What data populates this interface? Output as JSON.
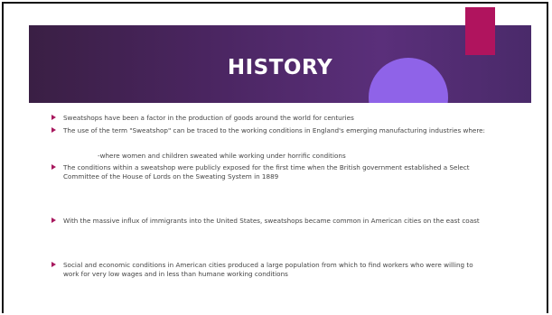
{
  "slide": {
    "title": "HISTORY",
    "bullets": [
      "Sweatshops have been a factor in the production of goods around the world for centuries",
      "The use of the term \"Sweatshop\" can be traced to the working conditions in England's emerging manufacturing industries where:",
      "The conditions within a sweatshop were publicly exposed for the first time when the British government established a Select Committee of the House of Lords on the Sweating System in 1889",
      "With the massive influx of immigrants into the United States, sweatshops became common in American cities on the east coast",
      "Social and economic conditions in American cities produced a large population from which to find workers who were willing to work for very low wages and in less than humane working conditions"
    ],
    "sub_item": "-where women and children sweated while working under horrific conditions"
  },
  "colors": {
    "banner": "#4a2560",
    "accent_magenta": "#b0145e",
    "accent_lavender": "#8f63e8",
    "bullet": "#a8185e"
  }
}
